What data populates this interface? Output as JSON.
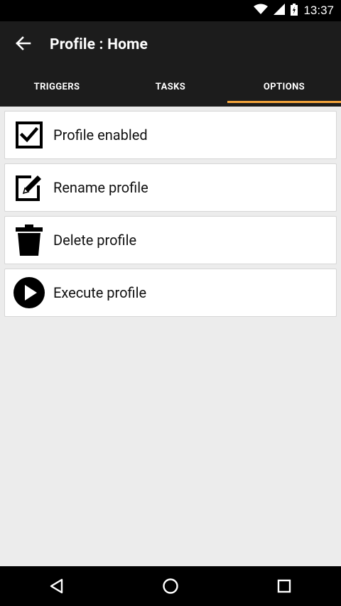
{
  "status_bar": {
    "time": "13:37",
    "icons": [
      "wifi-icon",
      "signal-icon",
      "battery-icon"
    ]
  },
  "app_bar": {
    "title": "Profile : Home",
    "back_icon": "arrow-left-icon"
  },
  "tabs": [
    {
      "label": "TRIGGERS",
      "active": false
    },
    {
      "label": "TASKS",
      "active": false
    },
    {
      "label": "OPTIONS",
      "active": true
    }
  ],
  "options": [
    {
      "label": "Profile enabled",
      "icon": "checkbox-checked-icon"
    },
    {
      "label": "Rename profile",
      "icon": "edit-icon"
    },
    {
      "label": "Delete profile",
      "icon": "trash-icon"
    },
    {
      "label": "Execute profile",
      "icon": "play-circle-icon"
    }
  ],
  "nav_bar": [
    "back-nav-icon",
    "home-nav-icon",
    "recents-nav-icon"
  ],
  "colors": {
    "app_bar": "#1c1c1c",
    "tab_indicator": "#f4a53c",
    "background": "#ececec"
  }
}
